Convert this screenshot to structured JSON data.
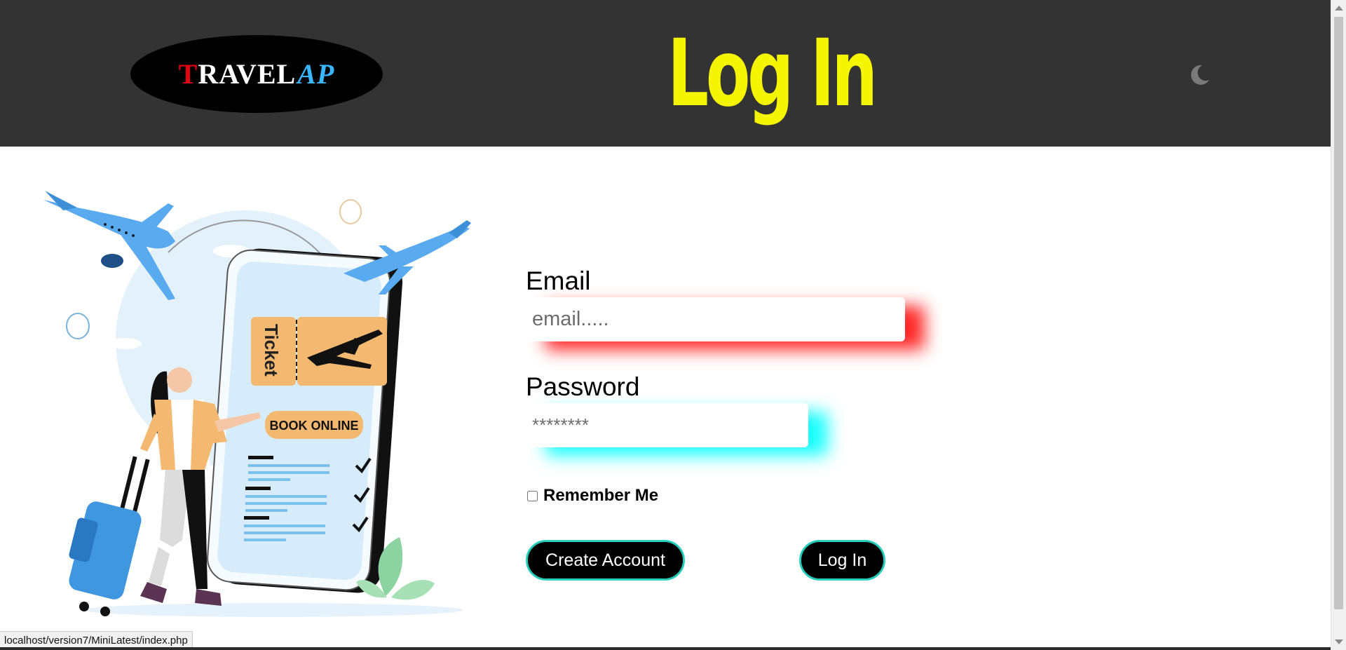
{
  "header": {
    "logo": {
      "first_letter": "T",
      "rest": "RAVEL",
      "accent": "AP"
    },
    "title": "Log In",
    "theme_toggle_icon": "moon-icon"
  },
  "illustration": {
    "ticket_label": "Ticket",
    "book_button_label": "BOOK ONLINE"
  },
  "form": {
    "email": {
      "label": "Email",
      "placeholder": "email.....",
      "value": ""
    },
    "password": {
      "label": "Password",
      "placeholder": "********",
      "value": ""
    },
    "remember_me": {
      "label": "Remember Me",
      "checked": false
    },
    "create_account_label": "Create Account",
    "login_label": "Log In"
  },
  "status_bar": {
    "url": "localhost/version7/MiniLatest/index.php"
  },
  "colors": {
    "header_bg": "#333333",
    "title_yellow": "#f5f500",
    "email_glow": "#ff0000",
    "password_glow": "#00ffff",
    "button_border": "#29d3c0"
  }
}
